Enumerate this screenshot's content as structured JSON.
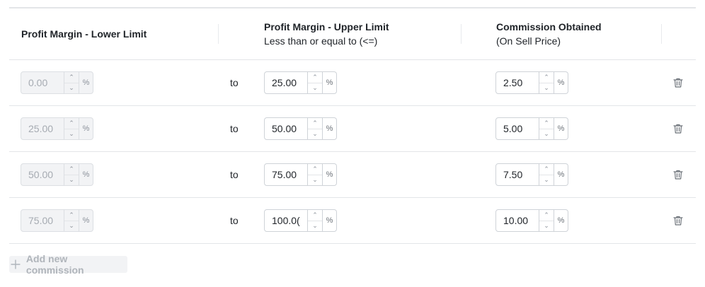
{
  "header": {
    "lower_limit": "Profit Margin - Lower Limit",
    "upper_limit": "Profit Margin - Upper Limit",
    "upper_limit_sub": "Less than or equal to (<=)",
    "commission": "Commission Obtained",
    "commission_sub": "(On Sell Price)"
  },
  "rows": [
    {
      "lower": "0.00",
      "to": "to",
      "upper": "25.00",
      "commission": "2.50"
    },
    {
      "lower": "25.00",
      "to": "to",
      "upper": "50.00",
      "commission": "5.00"
    },
    {
      "lower": "50.00",
      "to": "to",
      "upper": "75.00",
      "commission": "7.50"
    },
    {
      "lower": "75.00",
      "to": "to",
      "upper": "100.0(",
      "commission": "10.00"
    }
  ],
  "unit_symbol": "%",
  "add_label": "Add new commission",
  "icons": {
    "up": "chevron-up-icon",
    "down": "chevron-down-icon",
    "delete": "trash-icon",
    "add": "plus-icon"
  },
  "colors": {
    "border": "#cfd3d8",
    "disabled_bg": "#f2f3f5",
    "text": "#1f2328"
  }
}
